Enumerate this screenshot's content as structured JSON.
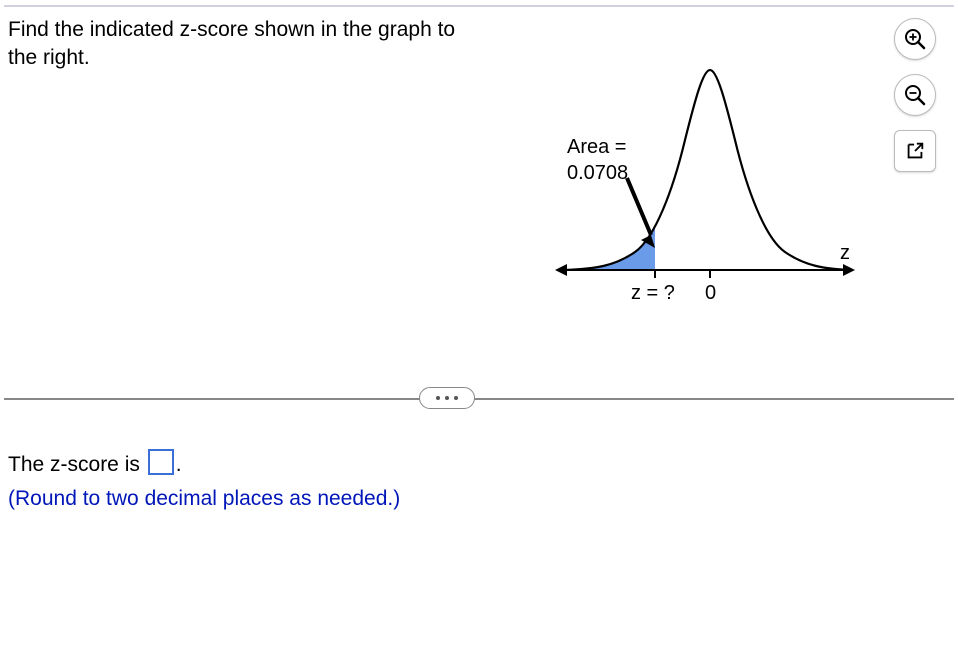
{
  "question": {
    "text": "Find the indicated z-score shown in the graph to the right."
  },
  "graph": {
    "area_label": "Area =",
    "area_value": "0.0708",
    "x_tick_unknown": "z = ?",
    "x_tick_zero": "0",
    "axis_label": "z"
  },
  "answer": {
    "prefix": "The z-score is ",
    "suffix": ".",
    "instruction": "(Round to two decimal places as needed.)"
  },
  "toolbar": {
    "zoom_in": "zoom-in",
    "zoom_out": "zoom-out",
    "popout": "popout"
  }
}
